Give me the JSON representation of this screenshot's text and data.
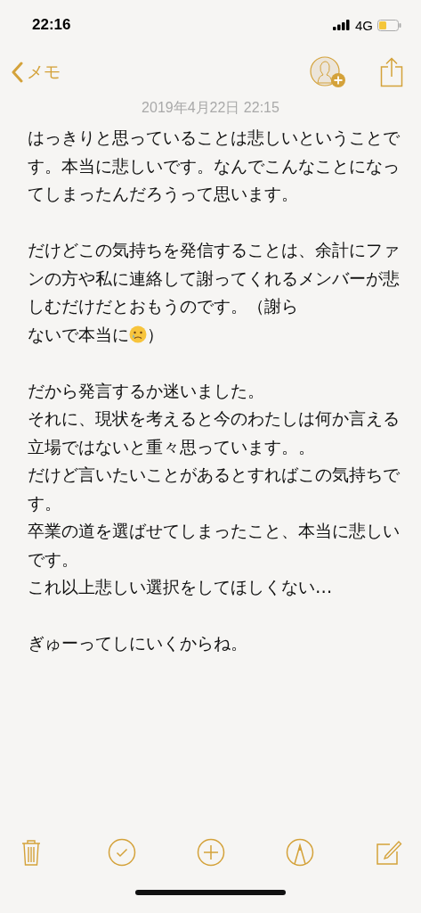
{
  "status_bar": {
    "time": "22:16",
    "network": "4G"
  },
  "nav": {
    "back_label": "メモ"
  },
  "note": {
    "date": "2019年4月22日 22:15",
    "paragraphs": [
      [
        {
          "kind": "text",
          "text": "はっきりと思っていることは悲しいということです。本当に悲しいです。なんでこんなことになってしまったんだろうって思います。"
        }
      ],
      [
        {
          "kind": "blank"
        }
      ],
      [
        {
          "kind": "text",
          "text": "だけどこの気持ちを発信することは、余計にファンの方や私に連絡して謝ってくれるメンバーが悲しむだけだとおもうのです。（謝ら"
        },
        {
          "kind": "break"
        },
        {
          "kind": "text",
          "text": "ないで本当に"
        },
        {
          "kind": "emoji"
        },
        {
          "kind": "text",
          "text": "）"
        }
      ],
      [
        {
          "kind": "blank"
        }
      ],
      [
        {
          "kind": "text",
          "text": "だから発言するか迷いました。"
        }
      ],
      [
        {
          "kind": "text",
          "text": "それに、現状を考えると今のわたしは何か言える立場ではないと重々思っています。。"
        }
      ],
      [
        {
          "kind": "text",
          "text": "だけど言いたいことがあるとすればこの気持ちです。"
        }
      ],
      [
        {
          "kind": "text",
          "text": "卒業の道を選ばせてしまったこと、本当に悲しいです。"
        }
      ],
      [
        {
          "kind": "text",
          "text": "これ以上悲しい選択をしてほしくない…"
        }
      ],
      [
        {
          "kind": "blank"
        }
      ],
      [
        {
          "kind": "text",
          "text": "ぎゅーってしにいくからね。"
        }
      ]
    ]
  },
  "toolbar": [
    {
      "kind": "trash"
    },
    {
      "kind": "checklist"
    },
    {
      "kind": "add"
    },
    {
      "kind": "markup"
    },
    {
      "kind": "compose"
    }
  ]
}
